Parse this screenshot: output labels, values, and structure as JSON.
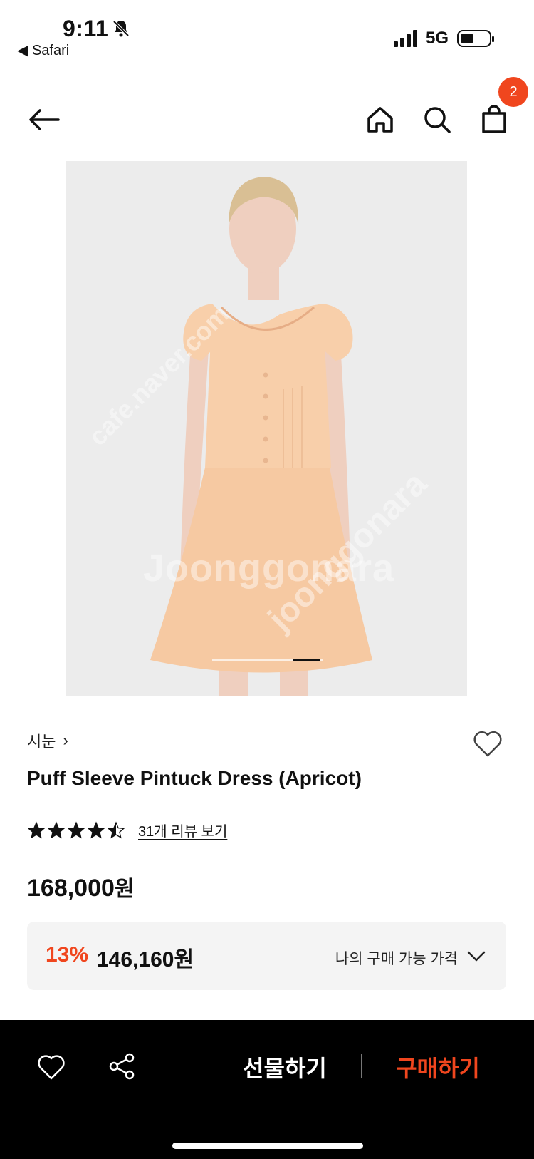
{
  "status_bar": {
    "time": "9:11",
    "back_app": "◀ Safari",
    "network": "5G",
    "icons": [
      "bell-slash-icon",
      "signal-icon",
      "battery-icon"
    ]
  },
  "nav": {
    "icons": [
      "back-arrow-icon",
      "home-icon",
      "search-icon",
      "shopping-bag-icon"
    ],
    "cart_count": "2"
  },
  "gallery": {
    "watermark": "Joonggonara",
    "watermark_diag_1": "cafe.naver.com",
    "watermark_diag_2": "joonggonara",
    "image_desc_colors": {
      "background": "#ececec",
      "dress": "#f6c9a2",
      "skin": "#efcfbf",
      "hair": "#d9bf94"
    }
  },
  "product": {
    "brand": "시눈",
    "brand_chevron": "›",
    "title": "Puff Sleeve Pintuck Dress (Apricot)",
    "rating": 4.5,
    "rating_max": 5,
    "review_link": "31개 리뷰 보기",
    "price": "168,000",
    "price_unit": "원"
  },
  "my_price": {
    "discount": "13%",
    "price": "146,160원",
    "label": "나의 구매 가능 가격",
    "icon": "chevron-down-icon"
  },
  "bottom_bar": {
    "gift_label": "선물하기",
    "buy_label": "구매하기",
    "icons": [
      "heart-icon",
      "share-icon"
    ]
  },
  "colors": {
    "accent": "#f0461e",
    "bottom_bar": "#000000",
    "price_box": "#f4f4f4"
  }
}
